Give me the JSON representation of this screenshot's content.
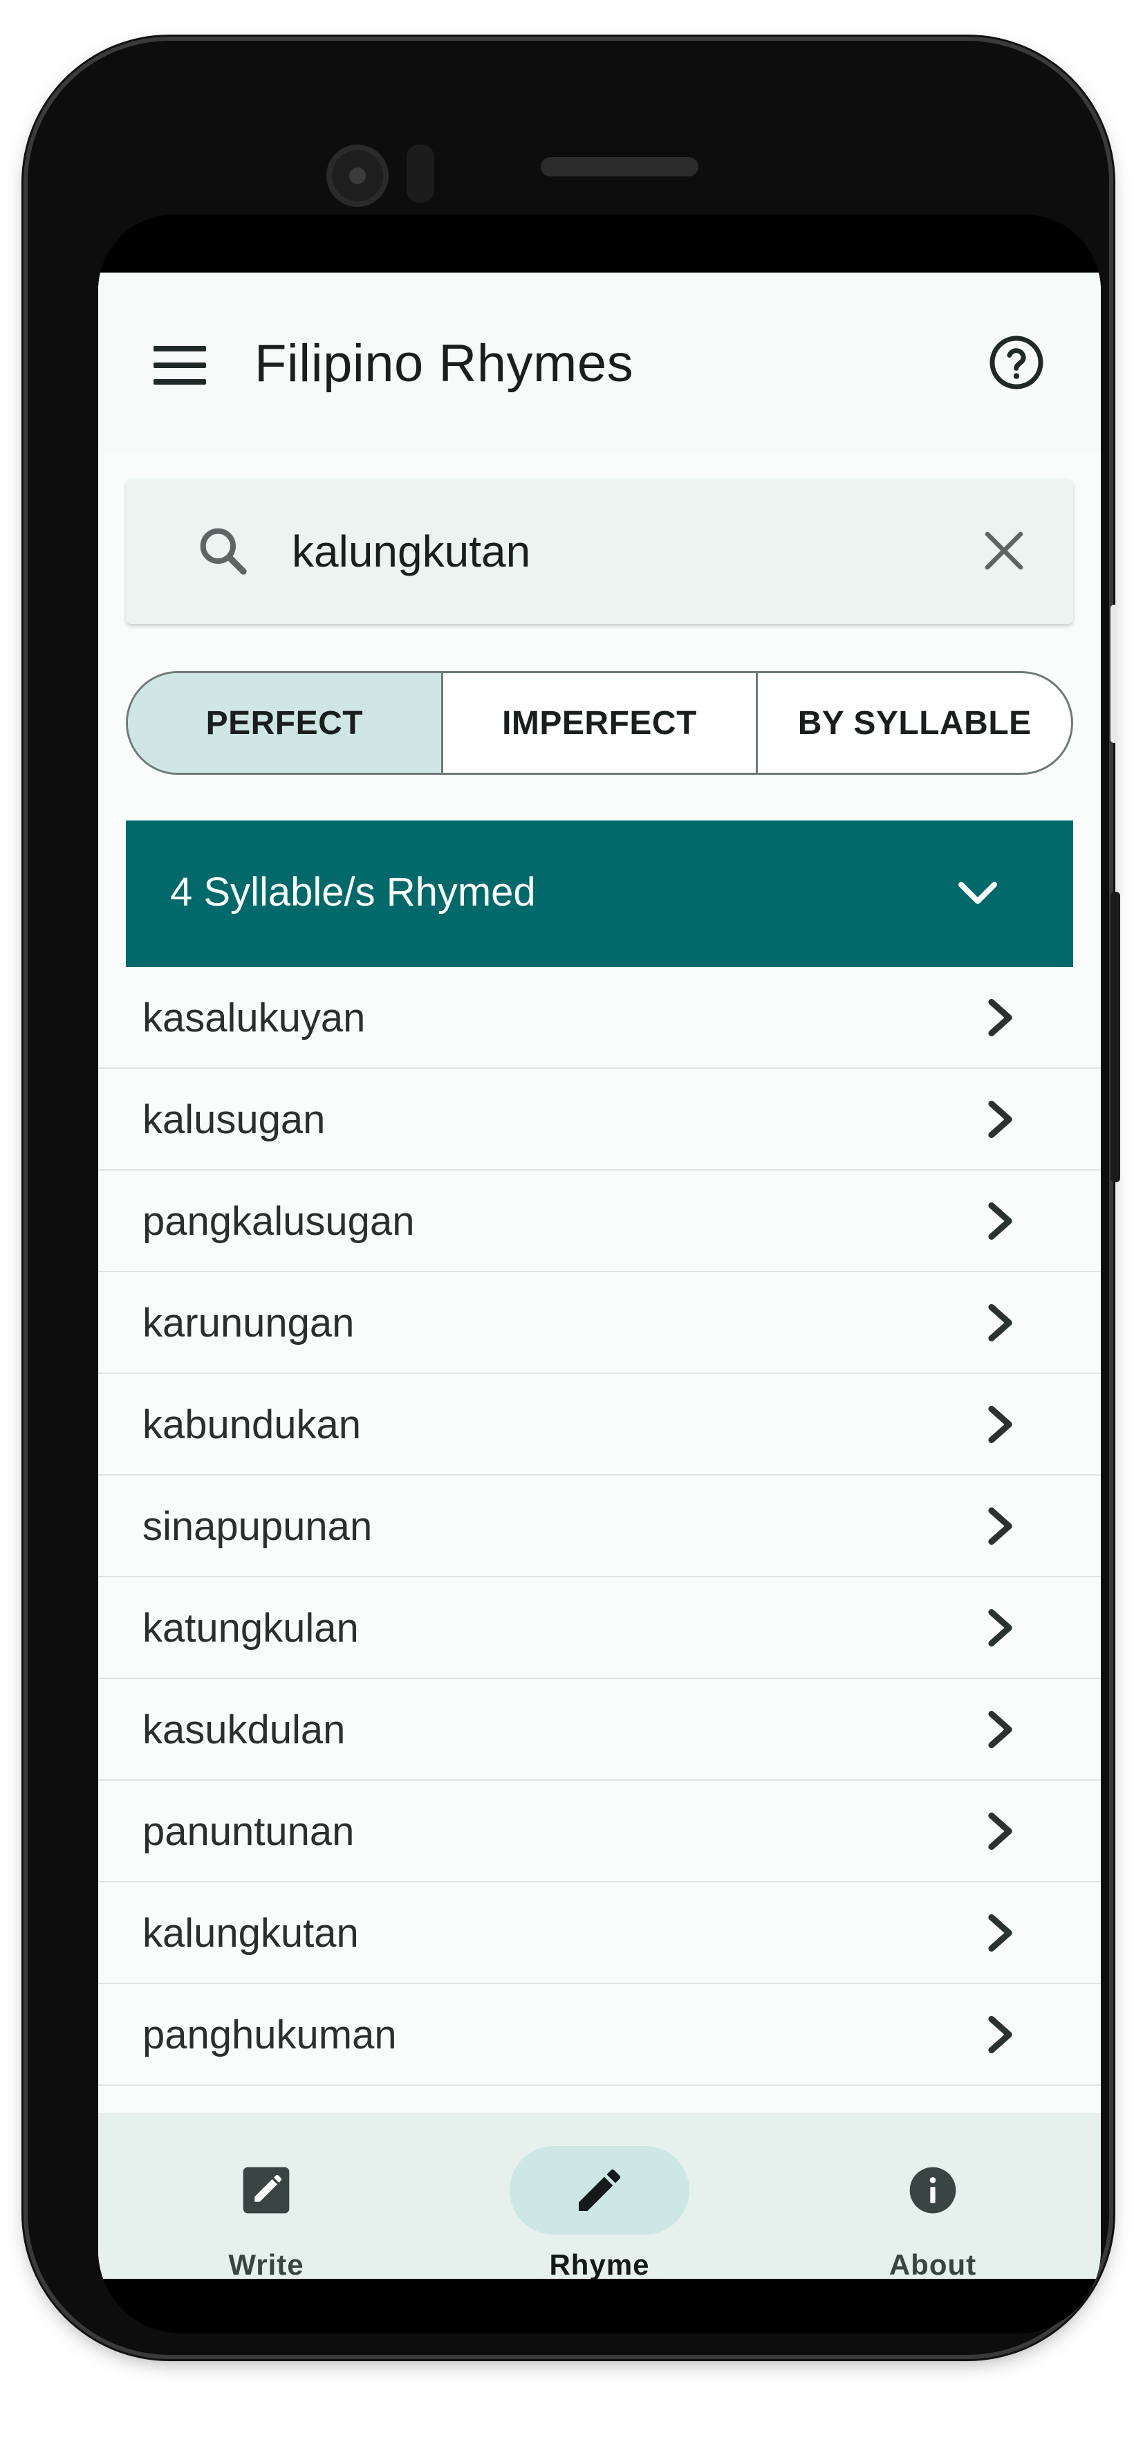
{
  "app": {
    "title": "Filipino Rhymes"
  },
  "icons": {
    "menu": "menu-icon",
    "help": "help-circle-icon",
    "search": "search-icon",
    "clear": "close-icon",
    "expand": "chevron-down-icon",
    "item": "chevron-right-icon"
  },
  "search": {
    "value": "kalungkutan",
    "placeholder": ""
  },
  "tabs": [
    {
      "label": "PERFECT",
      "active": true
    },
    {
      "label": "IMPERFECT",
      "active": false
    },
    {
      "label": "BY SYLLABLE",
      "active": false
    }
  ],
  "section": {
    "header": "4 Syllable/s Rhymed"
  },
  "results": [
    "kasalukuyan",
    "kalusugan",
    "pangkalusugan",
    "karunungan",
    "kabundukan",
    "sinapupunan",
    "katungkulan",
    "kasukdulan",
    "panuntunan",
    "kalungkutan",
    "panghukuman"
  ],
  "bottom_nav": [
    {
      "label": "Write",
      "icon": "edit-square-icon",
      "active": false
    },
    {
      "label": "Rhyme",
      "icon": "pencil-icon",
      "active": true
    },
    {
      "label": "About",
      "icon": "info-icon",
      "active": false
    }
  ],
  "colors": {
    "accent": "#02696a",
    "active_tab": "#cfe6e4",
    "bottom_nav_bg": "#e6f1ee",
    "search_bg": "#ebf4f1"
  }
}
